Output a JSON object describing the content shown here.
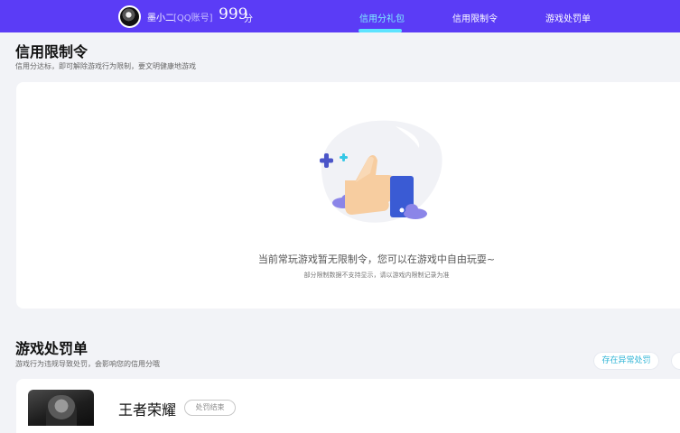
{
  "header": {
    "nickname": "墨小二",
    "account_tag": "[QQ账号]",
    "score_value": "999",
    "score_unit": "分",
    "tabs": [
      {
        "label": "信用分礼包",
        "active": true
      },
      {
        "label": "信用限制令",
        "active": false
      },
      {
        "label": "游戏处罚单",
        "active": false
      }
    ],
    "bar_color": "#5b3cf6",
    "active_color": "#7ef0ff"
  },
  "restriction": {
    "title": "信用限制令",
    "subtitle": "信用分达标，即可解除游戏行为限制，要文明健康地游戏",
    "empty_message": "当前常玩游戏暂无限制令，您可以在游戏中自由玩耍~",
    "empty_note": "部分限制数据不支持显示，请以游戏内限制记录为准"
  },
  "punishment": {
    "title": "游戏处罚单",
    "subtitle": "游戏行为违规导致处罚，会影响您的信用分哦",
    "filter_label": "存在异常处罚",
    "games": [
      {
        "name": "王者荣耀",
        "status": "处罚结束"
      }
    ]
  }
}
